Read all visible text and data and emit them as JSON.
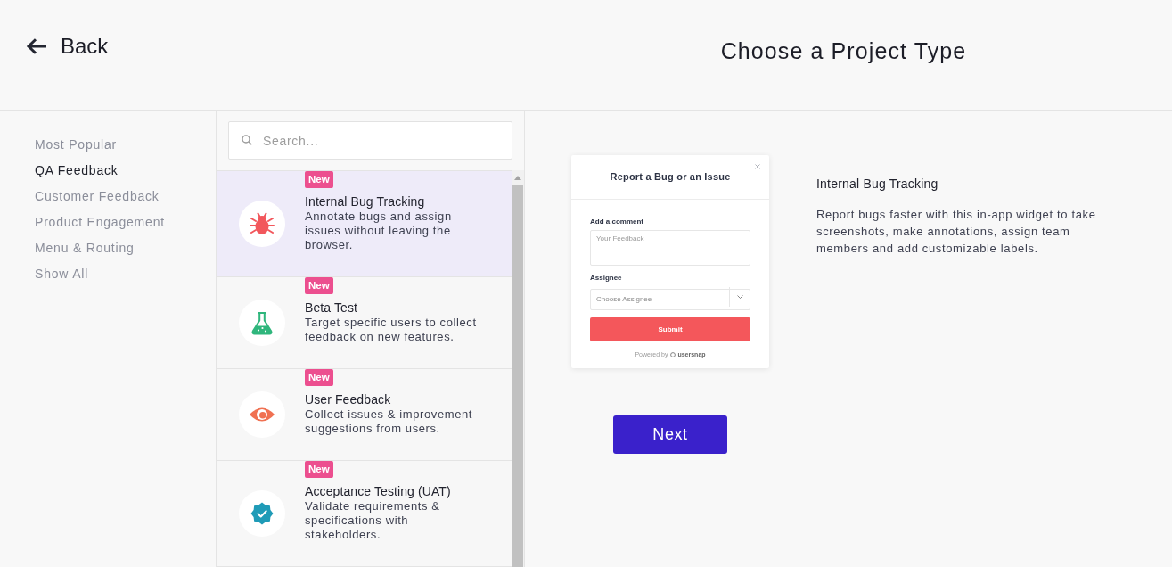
{
  "header": {
    "back_label": "Back",
    "title": "Choose a Project Type"
  },
  "sidebar": {
    "items": [
      {
        "label": "Most Popular",
        "selected": false
      },
      {
        "label": "QA Feedback",
        "selected": true
      },
      {
        "label": "Customer Feedback",
        "selected": false
      },
      {
        "label": "Product Engagement",
        "selected": false
      },
      {
        "label": "Menu & Routing",
        "selected": false
      },
      {
        "label": "Show All",
        "selected": false
      }
    ]
  },
  "search": {
    "placeholder": "Search..."
  },
  "project_types": [
    {
      "kind": "bug",
      "badge": "New",
      "title": "Internal Bug Tracking",
      "description": "Annotate bugs and assign issues without leaving the browser.",
      "selected": true
    },
    {
      "kind": "flask",
      "badge": "New",
      "title": "Beta Test",
      "description": "Target specific users to collect feedback on new features.",
      "selected": false
    },
    {
      "kind": "eye",
      "badge": "New",
      "title": "User Feedback",
      "description": "Collect issues & improvement suggestions from users.",
      "selected": false
    },
    {
      "kind": "check-badge",
      "badge": "New",
      "title": "Acceptance Testing (UAT)",
      "description": "Validate requirements & specifications with stakeholders.",
      "selected": false
    }
  ],
  "preview": {
    "widget": {
      "title": "Report a Bug or an Issue",
      "fields": [
        {
          "kind": "textarea",
          "label": "Add a comment",
          "placeholder": "Your Feedback"
        },
        {
          "kind": "select",
          "label": "Assignee",
          "placeholder": "Choose Assignee"
        }
      ],
      "submit_label": "Submit",
      "footer": "Powered by",
      "brand": "usersnap"
    },
    "title": "Internal Bug Tracking",
    "description": "Report bugs faster with this in-app widget to take screenshots, make annotations, assign team members and add customizable labels."
  },
  "next_label": "Next"
}
